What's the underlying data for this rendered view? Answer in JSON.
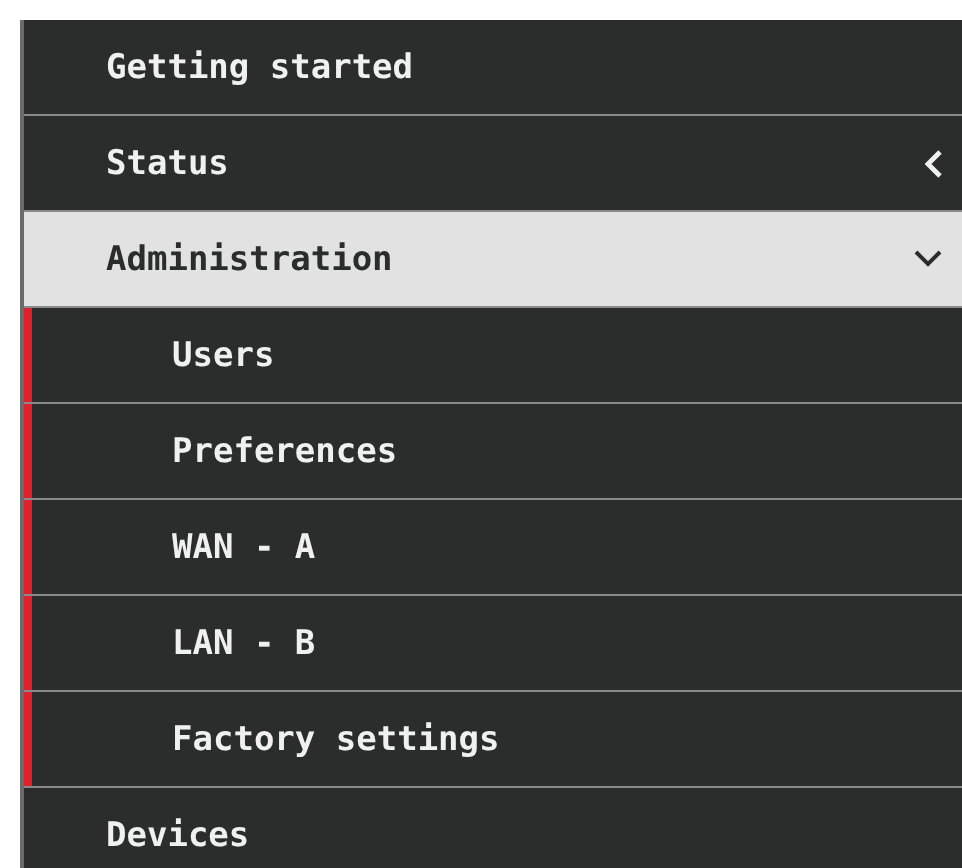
{
  "menu": [
    {
      "label": "Getting started",
      "selected": false
    },
    {
      "label": "Status",
      "selected": false,
      "expanded": false
    },
    {
      "label": "Administration",
      "selected": true,
      "expanded": true,
      "children": [
        {
          "label": "Users",
          "selected": false
        },
        {
          "label": "Preferences",
          "selected": false
        },
        {
          "label": "WAN - A",
          "selected": false
        },
        {
          "label": "LAN - B",
          "selected": false
        },
        {
          "label": "Factory settings",
          "selected": false
        }
      ]
    },
    {
      "label": "Devices",
      "selected": false
    }
  ]
}
